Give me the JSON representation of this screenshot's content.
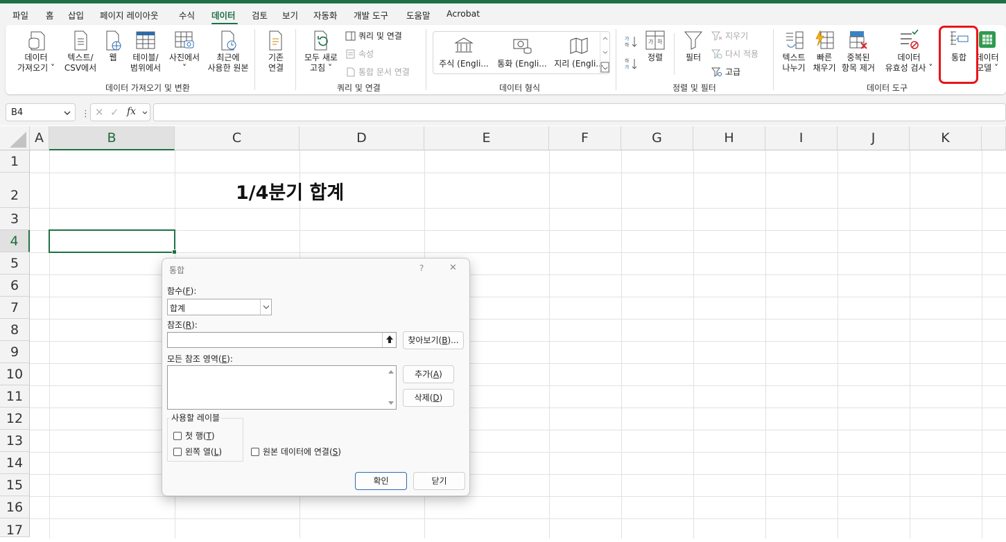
{
  "menu": {
    "tabs": [
      "파일",
      "홈",
      "삽입",
      "페이지 레이아웃",
      "수식",
      "데이터",
      "검토",
      "보기",
      "자동화",
      "개발 도구",
      "도움말",
      "Acrobat"
    ],
    "active_tab": "데이터"
  },
  "ribbon": {
    "get_data_group": {
      "label": "데이터 가져오기 및 변환",
      "get_data": [
        "데이터",
        "가져오기 ˅"
      ],
      "text_csv": [
        "텍스트/",
        "CSV에서"
      ],
      "web": "웹",
      "table_range": [
        "테이블/",
        "범위에서"
      ],
      "from_picture": [
        "사진에서",
        "˅"
      ],
      "recent_sources": [
        "최근에",
        "사용한 원본"
      ],
      "existing_connections": [
        "기존",
        "연결"
      ]
    },
    "queries_group": {
      "label": "쿼리 및 연결",
      "refresh_all": [
        "모두 새로",
        "고침 ˅"
      ],
      "queries_connections": "쿼리 및 연결",
      "properties": "속성",
      "edit_links": "통합 문서 연결"
    },
    "data_types_group": {
      "label": "데이터 형식",
      "items": [
        "주식 (Engli...",
        "통화 (Engli...",
        "지리 (Engli..."
      ]
    },
    "sort_filter_group": {
      "label": "정렬 및 필터",
      "sort": "정렬",
      "filter": "필터",
      "clear": "지우기",
      "reapply": "다시 적용",
      "advanced": "고급"
    },
    "data_tools_group": {
      "label": "데이터 도구",
      "text_to_columns": [
        "텍스트",
        "나누기"
      ],
      "flash_fill": [
        "빠른",
        "채우기"
      ],
      "remove_duplicates": [
        "중복된",
        "항목 제거"
      ],
      "data_validation": [
        "데이터",
        "유효성 검사 ˅"
      ],
      "consolidate": "통합",
      "data_model": [
        "데이터",
        "모델 ˅"
      ]
    }
  },
  "formula_bar": {
    "name_box": "B4",
    "fx": "fx",
    "formula": ""
  },
  "sheet": {
    "columns": [
      "A",
      "B",
      "C",
      "D",
      "E",
      "F",
      "G",
      "H",
      "I",
      "J",
      "K"
    ],
    "rows": [
      "1",
      "2",
      "3",
      "4",
      "5",
      "6",
      "7",
      "8",
      "9",
      "10",
      "11",
      "12",
      "13",
      "14",
      "15",
      "16",
      "17"
    ],
    "selected_column": "B",
    "selected_row": "4",
    "title_cell": "1/4분기 합계"
  },
  "dialog": {
    "title": "통합",
    "help": "?",
    "close": "✕",
    "function_label": "함수(",
    "function_key": "F",
    "function_value": "합계",
    "reference_label": "참조(",
    "reference_key": "R",
    "reference_value": "",
    "browse_button": "찾아보기(",
    "browse_key": "B",
    "all_refs_label": "모든 참조 영역(",
    "all_refs_key": "E",
    "add_button": "추가(",
    "add_key": "A",
    "delete_button": "삭제(",
    "delete_key": "D",
    "use_labels": "사용할 레이블",
    "top_row": "첫 행(",
    "top_row_key": "T",
    "left_column": "왼쪽 열(",
    "left_column_key": "L",
    "link_source": "원본 데이터에 연결(",
    "link_source_key": "S",
    "ok": "확인",
    "close_button": "닫기"
  },
  "colors": {
    "accent_green": "#1e7145",
    "highlight_red": "#e8141a"
  }
}
